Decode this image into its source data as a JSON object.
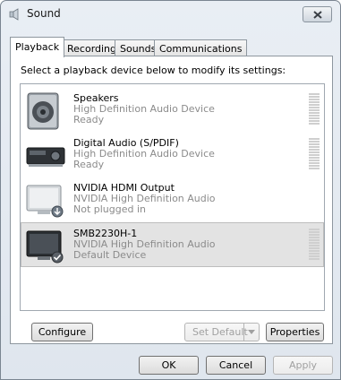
{
  "window": {
    "title": "Sound",
    "icon": "speaker-icon"
  },
  "tabs": [
    {
      "label": "Playback",
      "active": true
    },
    {
      "label": "Recording",
      "active": false
    },
    {
      "label": "Sounds",
      "active": false
    },
    {
      "label": "Communications",
      "active": false
    }
  ],
  "instruction": "Select a playback device below to modify its settings:",
  "devices": [
    {
      "name": "Speakers",
      "description": "High Definition Audio Device",
      "status": "Ready",
      "icon": "speakers-icon",
      "selected": false
    },
    {
      "name": "Digital Audio (S/PDIF)",
      "description": "High Definition Audio Device",
      "status": "Ready",
      "icon": "digital-audio-receiver-icon",
      "selected": false
    },
    {
      "name": "NVIDIA HDMI Output",
      "description": "NVIDIA High Definition Audio",
      "status": "Not plugged in",
      "icon": "monitor-unplugged-icon",
      "selected": false
    },
    {
      "name": "SMB2230H-1",
      "description": "NVIDIA High Definition Audio",
      "status": "Default Device",
      "icon": "monitor-default-icon",
      "selected": true
    }
  ],
  "buttons": {
    "configure": "Configure",
    "set_default": "Set Default",
    "properties": "Properties",
    "ok": "OK",
    "cancel": "Cancel",
    "apply": "Apply"
  }
}
